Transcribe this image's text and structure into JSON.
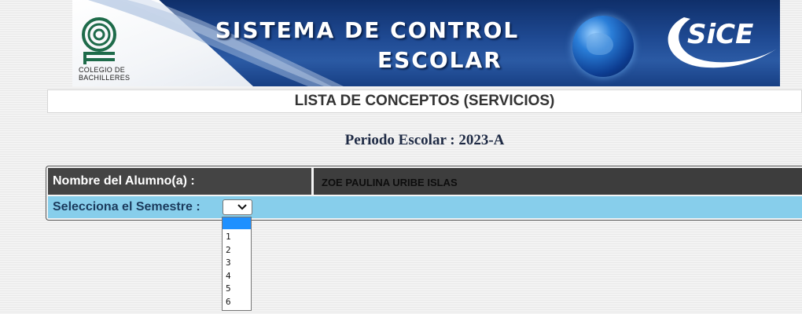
{
  "banner": {
    "org_name_line1": "COLEGIO DE",
    "org_name_line2": "BACHILLERES",
    "title_line1": "SISTEMA DE CONTROL",
    "title_line2": "ESCOLAR",
    "brand": "SiCE"
  },
  "header": {
    "title": "LISTA DE CONCEPTOS (SERVICIOS)"
  },
  "period": {
    "text": "Periodo Escolar : 2023-A"
  },
  "student": {
    "name_label": "Nombre del Alumno(a) :",
    "name_value": "ZOE PAULINA URIBE ISLAS",
    "semester_label": "Selecciona el Semestre :",
    "semester_selected": ""
  },
  "semester_options": [
    "",
    "1",
    "2",
    "3",
    "4",
    "5",
    "6"
  ],
  "colors": {
    "banner_blue": "#1f4a93",
    "row_blue": "#87ceeb",
    "dark_cell": "#444444",
    "selected_option": "#1e90ff"
  }
}
